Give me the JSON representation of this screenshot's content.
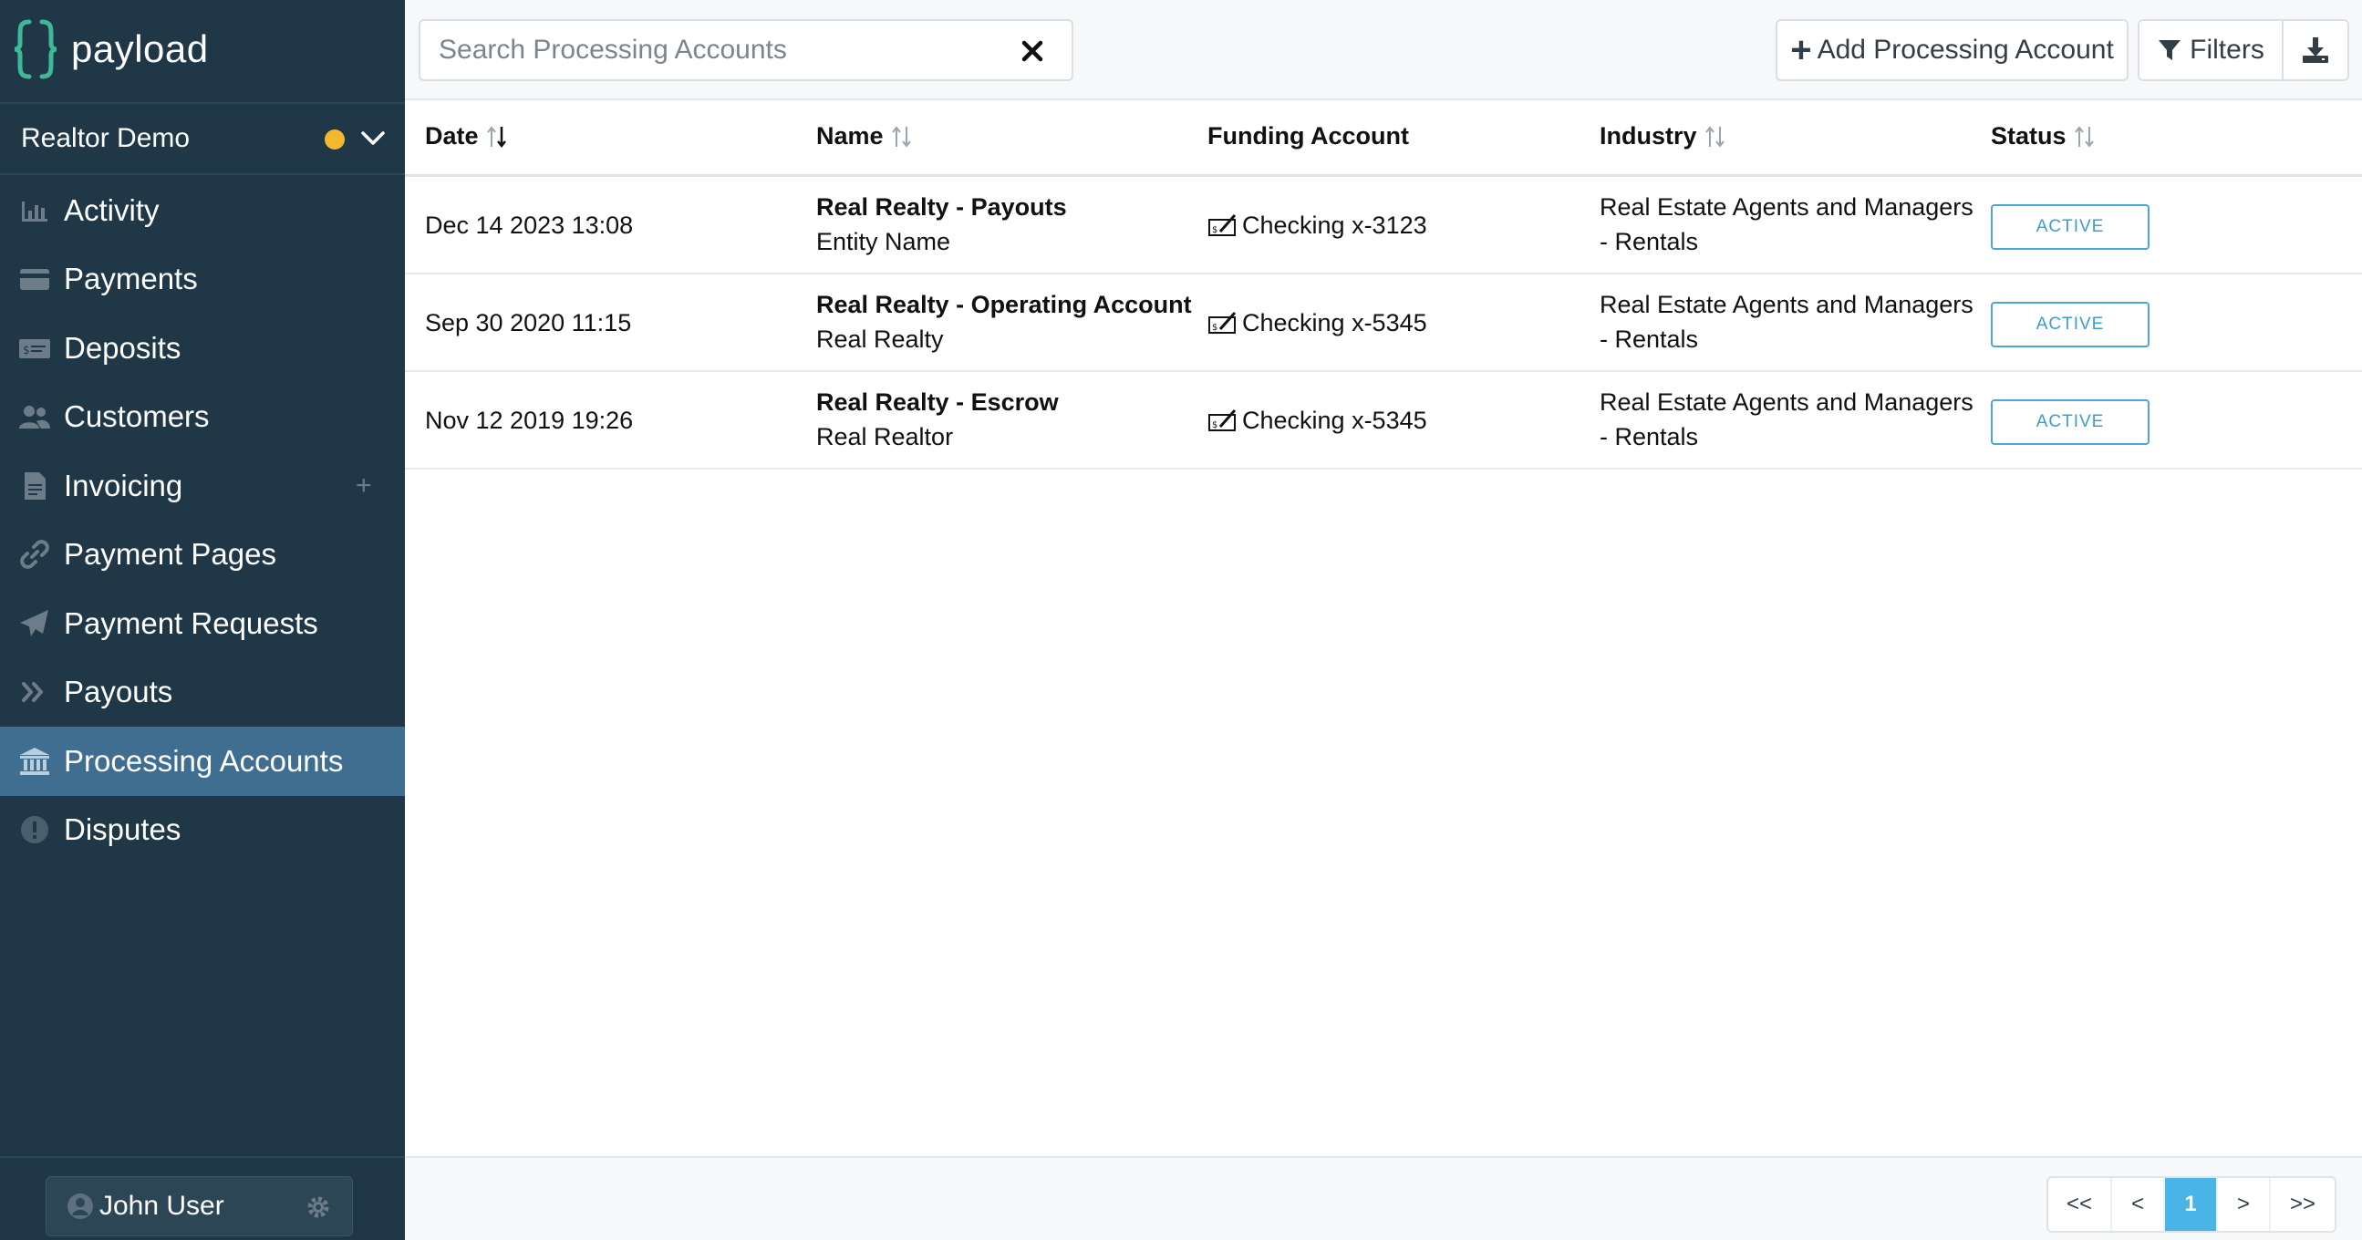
{
  "brand": {
    "name": "payload"
  },
  "org": {
    "name": "Realtor Demo",
    "status_color": "#f2b92e"
  },
  "sidebar": {
    "items": [
      {
        "label": "Activity",
        "icon": "bar-chart-icon"
      },
      {
        "label": "Payments",
        "icon": "credit-card-icon"
      },
      {
        "label": "Deposits",
        "icon": "deposit-icon"
      },
      {
        "label": "Customers",
        "icon": "users-icon"
      },
      {
        "label": "Invoicing",
        "icon": "invoice-icon",
        "action": "+"
      },
      {
        "label": "Payment Pages",
        "icon": "link-icon"
      },
      {
        "label": "Payment Requests",
        "icon": "paper-plane-icon"
      },
      {
        "label": "Payouts",
        "icon": "double-chevron-right-icon"
      },
      {
        "label": "Processing Accounts",
        "icon": "bank-icon",
        "active": true
      },
      {
        "label": "Disputes",
        "icon": "alert-circle-icon"
      }
    ],
    "user": {
      "name": "John User"
    }
  },
  "toolbar": {
    "search_placeholder": "Search Processing Accounts",
    "add_label": "Add Processing Account",
    "filters_label": "Filters"
  },
  "table": {
    "columns": [
      "Date",
      "Name",
      "Funding Account",
      "Industry",
      "Status"
    ],
    "rows": [
      {
        "date": "Dec 14 2023 13:08",
        "name": "Real Realty - Payouts",
        "subname": "Entity Name",
        "funding": "Checking x-3123",
        "industry": "Real Estate Agents and Managers - Rentals",
        "status": "ACTIVE"
      },
      {
        "date": "Sep 30 2020 11:15",
        "name": "Real Realty - Operating Account",
        "subname": "Real Realty",
        "funding": "Checking x-5345",
        "industry": "Real Estate Agents and Managers - Rentals",
        "status": "ACTIVE"
      },
      {
        "date": "Nov 12 2019 19:26",
        "name": "Real Realty - Escrow",
        "subname": "Real Realtor",
        "funding": "Checking x-5345",
        "industry": "Real Estate Agents and Managers - Rentals",
        "status": "ACTIVE"
      }
    ]
  },
  "pagination": {
    "first": "<<",
    "prev": "<",
    "current": "1",
    "next": ">",
    "last": ">>"
  },
  "colors": {
    "sidebar_bg": "#1f3746",
    "active_nav": "#3f6e91",
    "accent": "#4ab4e6",
    "status_active": "#3a9ed0"
  }
}
